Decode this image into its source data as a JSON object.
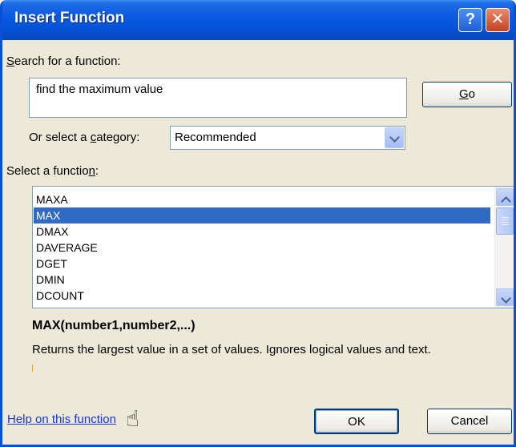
{
  "window": {
    "title": "Insert Function",
    "help_button": "?",
    "close_button": "✕"
  },
  "search": {
    "label_prefix": "",
    "label_accel": "S",
    "label_rest": "earch for a function:",
    "value": "find the maximum value",
    "go_accel": "G",
    "go_rest": "o"
  },
  "category": {
    "label_prefix": "Or select a ",
    "label_accel": "c",
    "label_rest": "ategory:",
    "selected": "Recommended"
  },
  "function_list": {
    "label_prefix": "Select a functio",
    "label_accel": "n",
    "label_rest": ":",
    "items": [
      "MAXA",
      "MAX",
      "DMAX",
      "DAVERAGE",
      "DGET",
      "DMIN",
      "DCOUNT"
    ],
    "selected_index": 1
  },
  "details": {
    "signature": "MAX(number1,number2,...)",
    "description": "Returns the largest value in a set of values. Ignores logical values and text."
  },
  "footer": {
    "help_link": "Help on this function",
    "ok_label": "OK",
    "cancel_label": "Cancel"
  },
  "colors": {
    "titlebar": "#0a5ae0",
    "dialog_background": "#ece9d8",
    "selection": "#316ac5",
    "link": "#1a35d9"
  }
}
